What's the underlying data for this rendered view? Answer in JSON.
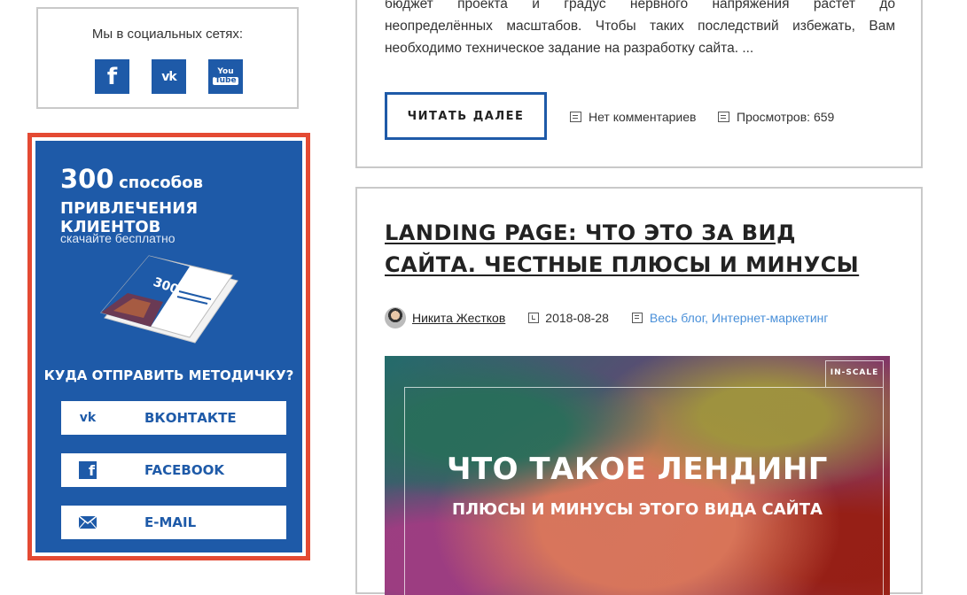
{
  "social": {
    "title": "Мы в социальных сетях:",
    "icons": [
      "facebook-icon",
      "vk-icon",
      "youtube-icon"
    ],
    "fb_glyph": "f",
    "vk_glyph": "vk",
    "yt_top": "You",
    "yt_bottom": "Tube"
  },
  "promo": {
    "number": "300",
    "title_line1": "способов",
    "title_line2": "ПРИВЛЕЧЕНИЯ КЛИЕНТОВ",
    "caption": "скачайте бесплатно",
    "brochure_number": "300",
    "question": "КУДА ОТПРАВИТЬ МЕТОДИЧКУ?",
    "buttons": [
      {
        "label": "ВКОНТАКТЕ",
        "icon": "vk-icon"
      },
      {
        "label": "FACEBOOK",
        "icon": "facebook-icon"
      },
      {
        "label": "E-MAIL",
        "icon": "envelope-icon"
      }
    ],
    "colors": {
      "background": "#1e5aa8",
      "border": "#e44a33"
    }
  },
  "article1": {
    "excerpt_line1": "бюджет проекта и градус нервного напряжения растет до",
    "excerpt_line2": "неопределённых масштабов. Чтобы таких последствий избежать, Вам",
    "excerpt_line3": "необходимо техническое задание на разработку сайта. ...",
    "read_more": "ЧИТАТЬ ДАЛЕЕ",
    "comments": "Нет комментариев",
    "views": "Просмотров: 659"
  },
  "article2": {
    "title": "LANDING PAGE: ЧТО ЭТО ЗА ВИД САЙТА. ЧЕСТНЫЕ ПЛЮСЫ И МИНУСЫ",
    "author": "Никита Жестков",
    "date": "2018-08-28",
    "categories": "Весь блог, Интернет-маркетинг",
    "hero": {
      "badge": "IN-SCALE",
      "title": "ЧТО ТАКОЕ ЛЕНДИНГ",
      "subtitle": "ПЛЮСЫ И МИНУСЫ ЭТОГО ВИДА САЙТА"
    }
  }
}
